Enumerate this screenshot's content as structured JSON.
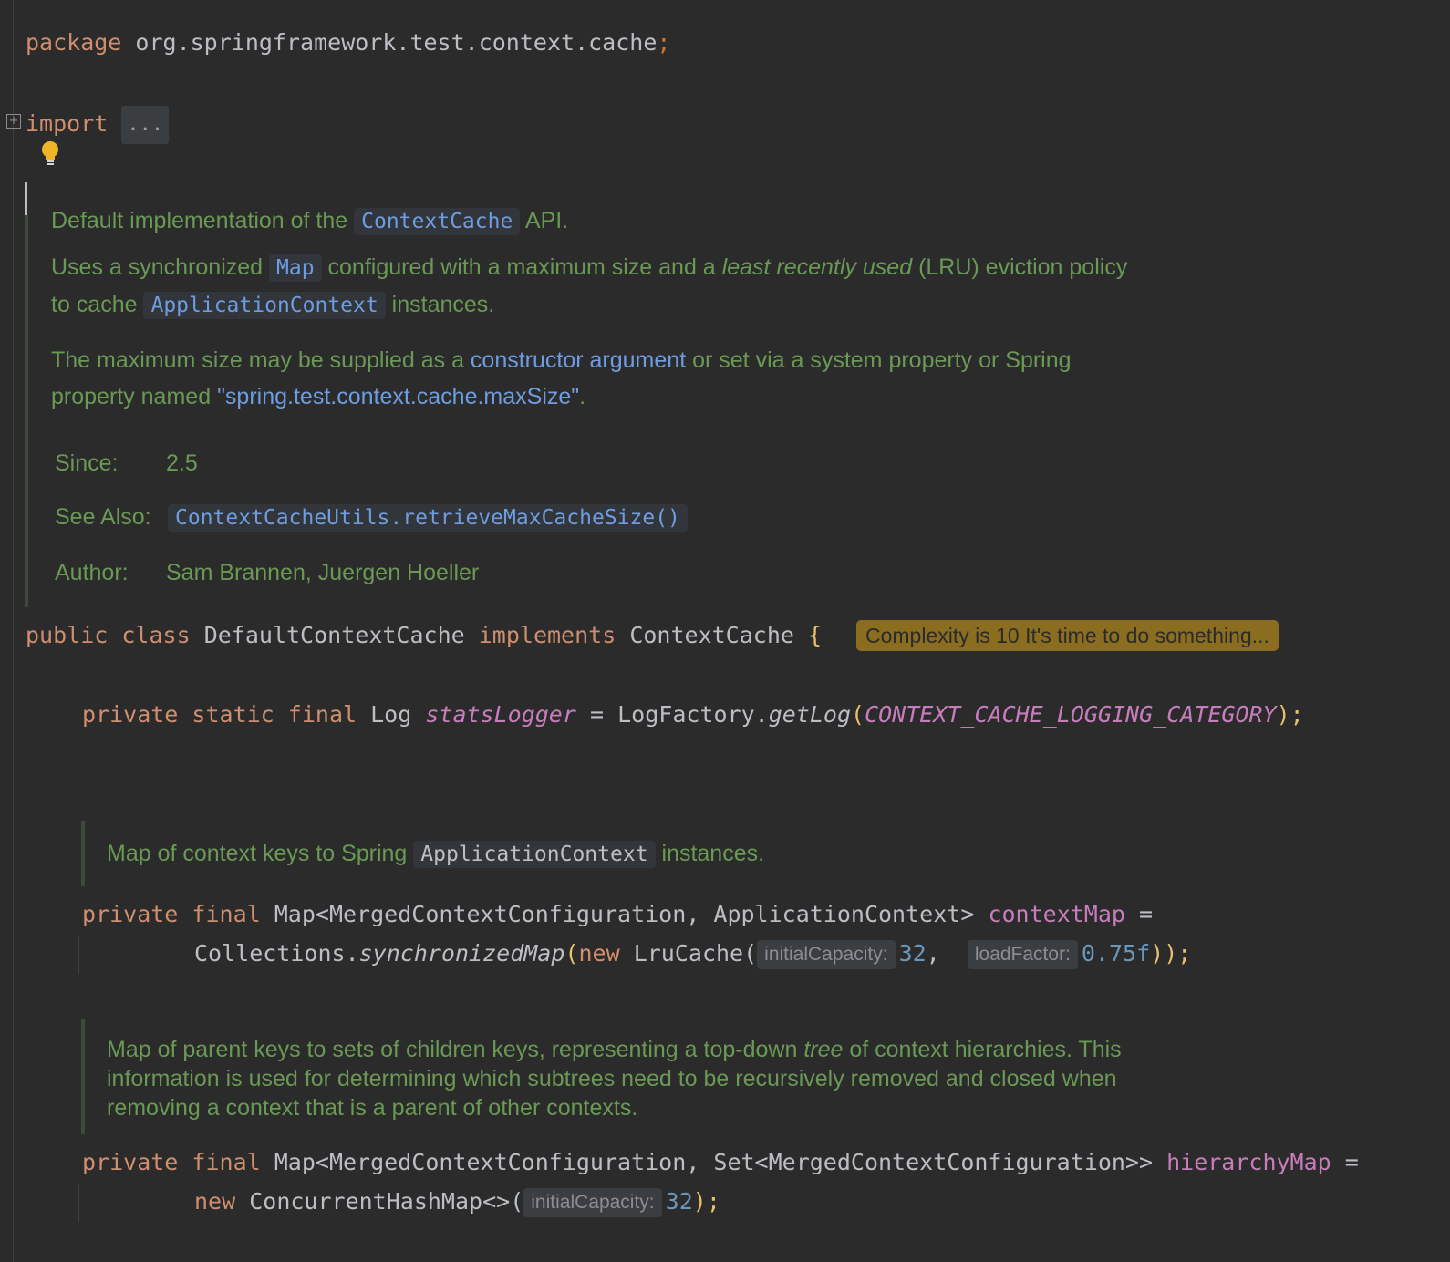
{
  "code": {
    "package_kw": "package",
    "package_name": "org.springframework.test.context.cache",
    "semicolon": ";",
    "import_kw": "import",
    "import_fold": "...",
    "class_decl": {
      "public": "public",
      "class": "class",
      "name": "DefaultContextCache",
      "implements": "implements",
      "iface": "ContextCache",
      "brace": "{"
    },
    "stats_field": {
      "private": "private",
      "static": "static",
      "final": "final",
      "type": "Log",
      "name": "statsLogger",
      "eq": "=",
      "factory": "LogFactory.",
      "method": "getLog",
      "arg": "CONTEXT_CACHE_LOGGING_CATEGORY",
      "end": ");"
    },
    "context_map": {
      "private": "private",
      "final": "final",
      "type_open": "Map<MergedContextConfiguration, ApplicationContext>",
      "name": "contextMap",
      "eq": "=",
      "collections": "Collections.",
      "method": "synchronizedMap",
      "new": "new",
      "ctor": "LruCache(",
      "hint1": "initialCapacity:",
      "val1": "32",
      "comma": ",",
      "hint2": "loadFactor:",
      "val2": "0.75f",
      "end": "));"
    },
    "hierarchy_map": {
      "private": "private",
      "final": "final",
      "type": "Map<MergedContextConfiguration, Set<MergedContextConfiguration>>",
      "name": "hierarchyMap",
      "eq": "=",
      "new": "new",
      "ctor": "ConcurrentHashMap<>(",
      "hint1": "initialCapacity:",
      "val1": "32",
      "end": ");"
    }
  },
  "class_doc": {
    "p1_pre": "Default implementation of the",
    "p1_code": "ContextCache",
    "p1_post": "API.",
    "p2_pre": "Uses a synchronized",
    "p2_code": "Map",
    "p2_mid": "configured with a maximum size and a",
    "p2_em": "least recently used",
    "p2_post": "(LRU) eviction policy",
    "p2b_pre": "to cache",
    "p2b_code": "ApplicationContext",
    "p2b_post": "instances.",
    "p3_pre": "The maximum size may be supplied as a",
    "p3_link": "constructor argument",
    "p3_post": "or set via a system property or Spring",
    "p3b_pre": "property named",
    "p3b_link": "\"spring.test.context.cache.maxSize\"",
    "p3b_post": ".",
    "since_label": "Since:",
    "since_value": "2.5",
    "see_label": "See Also:",
    "see_value": "ContextCacheUtils.retrieveMaxCacheSize()",
    "author_label": "Author:",
    "author_value": "Sam Brannen, Juergen Hoeller"
  },
  "context_map_doc": {
    "pre": "Map of context keys to Spring",
    "code": "ApplicationContext",
    "post": "instances."
  },
  "hierarchy_doc": {
    "line1_pre": "Map of parent keys to sets of children keys, representing a top-down",
    "line1_em": "tree",
    "line1_post": "of context hierarchies. This",
    "line2": "information is used for determining which subtrees need to be recursively removed and closed when",
    "line3": "removing a context that is a parent of other contexts."
  },
  "complexity_badge": "Complexity is 10 It's time to do something...",
  "icons": {
    "fold": "plus-box-icon",
    "bulb": "lightbulb-icon"
  },
  "colors": {
    "background": "#2b2b2b",
    "keyword": "#cf8e6d",
    "doc_text": "#6a9955",
    "field": "#c77dbb",
    "badge": "#8a6d1e"
  }
}
